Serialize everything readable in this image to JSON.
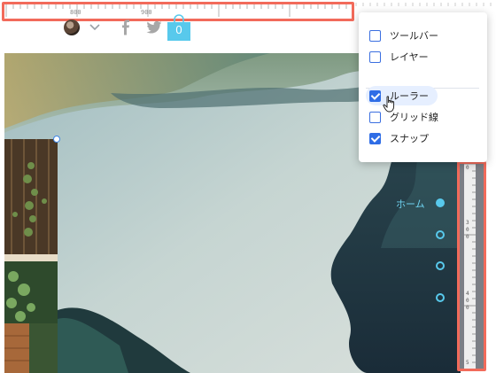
{
  "ruler_top": {
    "labels": [
      "800",
      "900"
    ]
  },
  "header": {
    "cart_count": "0"
  },
  "nav": {
    "home_label": "ホーム",
    "dots": 4
  },
  "ruler_right": {
    "labels": [
      "0",
      "3",
      "0",
      "0",
      "4",
      "0",
      "0",
      "5"
    ]
  },
  "menu": {
    "items": [
      {
        "label": "ツールバー",
        "checked": false
      },
      {
        "label": "レイヤー",
        "checked": false
      },
      {
        "label": "ルーラー",
        "checked": true
      },
      {
        "label": "グリッド線",
        "checked": false
      },
      {
        "label": "スナップ",
        "checked": true
      }
    ]
  },
  "colors": {
    "accent": "#58c9ec",
    "highlight": "#f26b5b",
    "checkbox": "#2f6de6",
    "selection": "#3f86e6"
  }
}
